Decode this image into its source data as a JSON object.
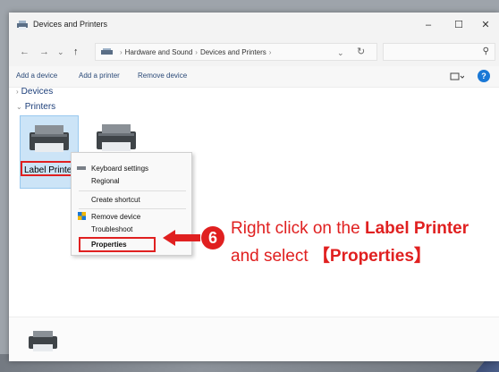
{
  "window": {
    "title": "Devices and Printers",
    "controls": [
      "–",
      "☐",
      "✕"
    ]
  },
  "nav": {
    "back": "←",
    "forward": "→",
    "recent": "⌄",
    "up": "↑",
    "crumbs": [
      "Hardware and Sound",
      "Devices and Printers"
    ],
    "dropdown": "⌄",
    "refresh": "↻",
    "search_icon": "⚲"
  },
  "toolbar": {
    "add_device": "Add a device",
    "add_printer": "Add a printer",
    "remove_device": "Remove device"
  },
  "groups": {
    "devices": "Devices",
    "printers": "Printers"
  },
  "printers": [
    {
      "label": "Label Printer"
    },
    {
      "label": ""
    }
  ],
  "context_menu": {
    "items": [
      "Keyboard settings",
      "Regional",
      "Create shortcut",
      "Remove device",
      "Troubleshoot",
      "Properties"
    ]
  },
  "instruction": {
    "step": "6",
    "line1_pre": "Right click on the ",
    "line1_bold": "Label Printer",
    "line2_pre": "and select ",
    "line2_bold": "【Properties】"
  },
  "colors": {
    "accent_red": "#e02020",
    "selection": "#cce4f7",
    "link_blue": "#2b4a78"
  },
  "icons": {
    "title": "devices-printers-icon",
    "printer": "printer-icon",
    "help": "help-icon"
  }
}
